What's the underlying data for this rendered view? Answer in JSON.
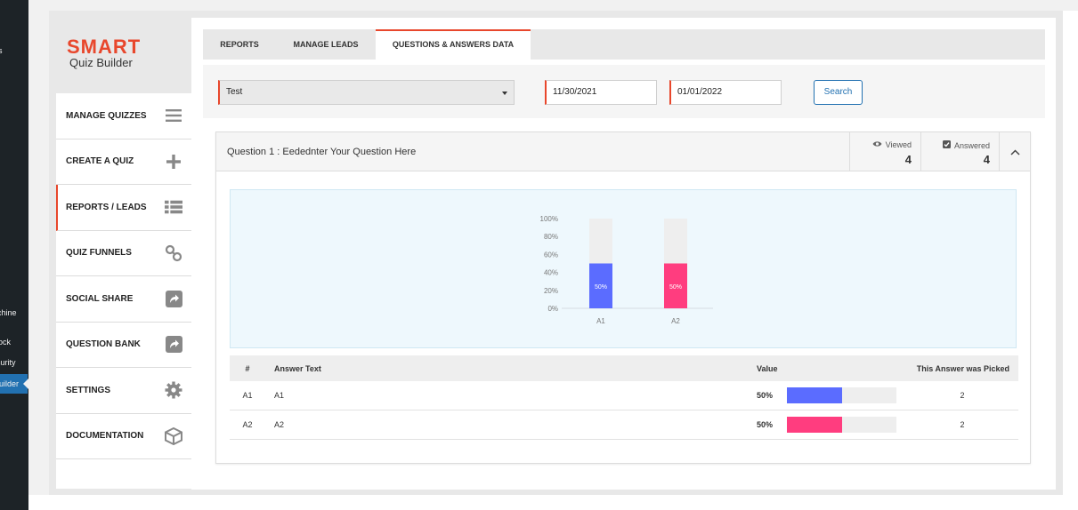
{
  "wp_sidebar": {
    "items": [
      "s",
      "chine",
      "ock",
      "curity",
      "uilder"
    ]
  },
  "brand": {
    "logo_main": "SMART",
    "logo_sub": "Quiz Builder",
    "accent": "#e8472c"
  },
  "menu": [
    {
      "label": "MANAGE QUIZZES",
      "icon": "list-lines-icon"
    },
    {
      "label": "CREATE A QUIZ",
      "icon": "plus-icon"
    },
    {
      "label": "REPORTS / LEADS",
      "icon": "list-bullets-icon",
      "active": true
    },
    {
      "label": "QUIZ FUNNELS",
      "icon": "chain-link-icon"
    },
    {
      "label": "SOCIAL SHARE",
      "icon": "share-arrow-icon"
    },
    {
      "label": "QUESTION BANK",
      "icon": "share-arrow-icon"
    },
    {
      "label": "SETTINGS",
      "icon": "gear-icon"
    },
    {
      "label": "DOCUMENTATION",
      "icon": "cube-icon"
    }
  ],
  "tabs": [
    {
      "label": "REPORTS"
    },
    {
      "label": "MANAGE LEADS"
    },
    {
      "label": "QUESTIONS & ANSWERS DATA",
      "active": true
    }
  ],
  "filters": {
    "quiz_selected": "Test",
    "date_from": "11/30/2021",
    "date_to": "01/01/2022",
    "search_label": "Search"
  },
  "question": {
    "title": "Question 1 : Eedednter Your Question Here",
    "viewed_label": "Viewed",
    "viewed_count": "4",
    "answered_label": "Answered",
    "answered_count": "4"
  },
  "chart_data": {
    "type": "bar",
    "categories": [
      "A1",
      "A2"
    ],
    "values": [
      50,
      50
    ],
    "value_labels": [
      "50%",
      "50%"
    ],
    "colors": [
      "#5b6cff",
      "#ff3d7f"
    ],
    "ylim": [
      0,
      100
    ],
    "yticks": [
      "0%",
      "20%",
      "40%",
      "60%",
      "80%",
      "100%"
    ]
  },
  "table": {
    "headers": {
      "num": "#",
      "text": "Answer Text",
      "value": "Value",
      "picked": "This Answer was Picked"
    },
    "rows": [
      {
        "num": "A1",
        "text": "A1",
        "value": "50%",
        "fraction": 0.5,
        "color": "#5b6cff",
        "picked": "2"
      },
      {
        "num": "A2",
        "text": "A2",
        "value": "50%",
        "fraction": 0.5,
        "color": "#ff3d7f",
        "picked": "2"
      }
    ]
  }
}
